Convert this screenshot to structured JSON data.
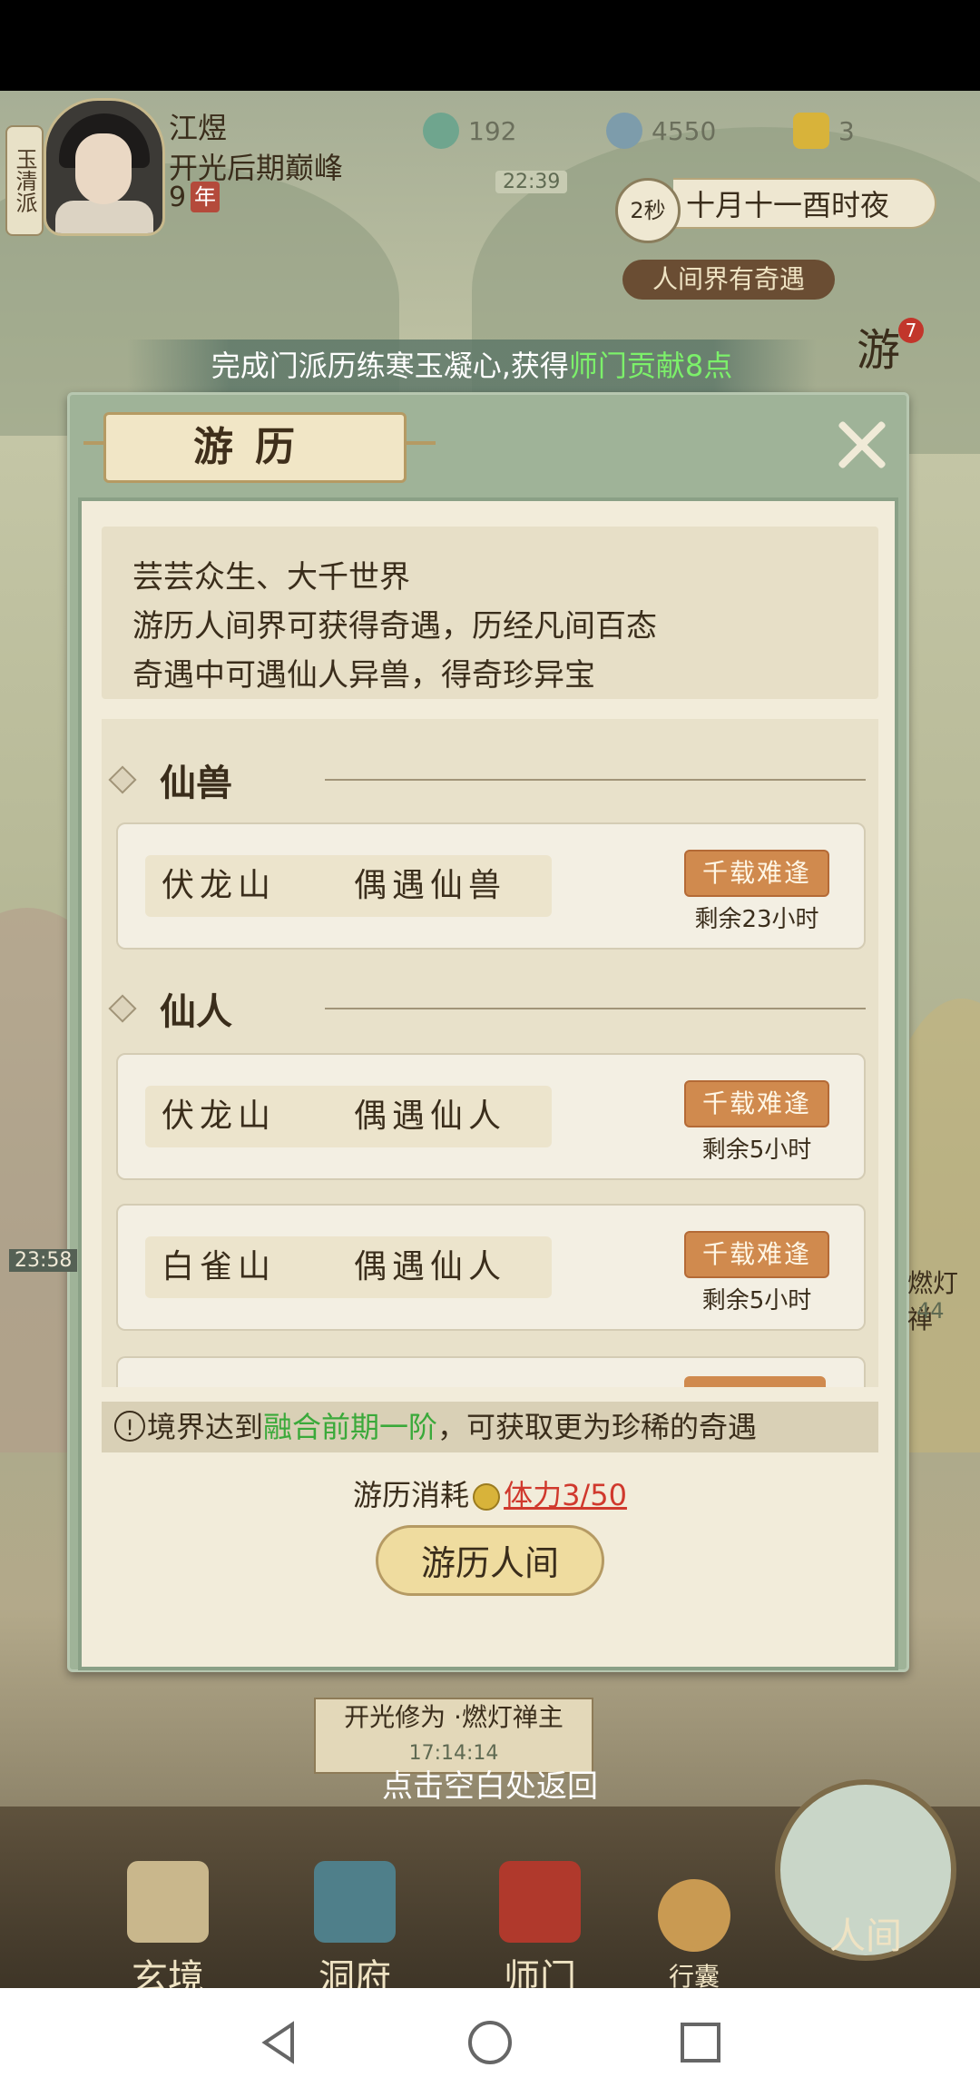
{
  "header": {
    "sect": "玉清派",
    "player_name": "江煜",
    "realm": "开光后期巅峰",
    "age": "9",
    "age_unit": "年",
    "resources": [
      {
        "icon": "jade-spirit-icon",
        "value": "192"
      },
      {
        "icon": "coin-icon",
        "value": "4550"
      },
      {
        "icon": "gold-ingot-icon",
        "value": "3"
      }
    ],
    "clock": "22:39",
    "timer": "2秒",
    "game_date": "十月十一酉时夜",
    "event_pill": "人间界有奇遇",
    "side_badge": "游",
    "side_badge_count": "7"
  },
  "notice": {
    "prefix": "完成门派历练寒玉凝心,获得",
    "reward": "师门贡献8点"
  },
  "dialog": {
    "title": "游历",
    "description": [
      "芸芸众生、大千世界",
      "游历人间界可获得奇遇，历经凡间百态",
      "奇遇中可遇仙人异兽，得奇珍异宝"
    ],
    "sections": [
      {
        "title": "仙兽",
        "items": [
          {
            "location": "伏龙山",
            "event": "偶遇仙兽",
            "tag": "千载难逢",
            "remaining": "剩余23小时"
          }
        ]
      },
      {
        "title": "仙人",
        "items": [
          {
            "location": "伏龙山",
            "event": "偶遇仙人",
            "tag": "千载难逢",
            "remaining": "剩余5小时"
          },
          {
            "location": "白雀山",
            "event": "偶遇仙人",
            "tag": "千载难逢",
            "remaining": "剩余5小时"
          }
        ]
      }
    ],
    "hint_prefix": "境界达到",
    "hint_highlight": "融合前期一阶",
    "hint_suffix": "，可获取更为珍稀的奇遇",
    "cost_label": "游历消耗",
    "cost_value": "体力3/50",
    "travel_button": "游历人间"
  },
  "background": {
    "under_card_line1": "开光修为 ·燃灯禅主",
    "under_card_line2": "17:14:14",
    "left_time": "23:58",
    "right_label": "燃灯禅",
    "right_time": "44",
    "return_hint": "点击空白处返回"
  },
  "bottom_nav": [
    {
      "label": "玄境",
      "icon": "scroll-icon"
    },
    {
      "label": "洞府",
      "icon": "pavilion-icon"
    },
    {
      "label": "师门",
      "icon": "banner-icon"
    },
    {
      "label": "行囊",
      "icon": "bag-icon"
    },
    {
      "label": "人间",
      "icon": "landscape-icon"
    }
  ],
  "colors": {
    "highlight_green": "#7cf06a",
    "hint_green": "#3aa93a",
    "tag_orange": "#d08a4e",
    "stamina_red": "#d0392d"
  }
}
